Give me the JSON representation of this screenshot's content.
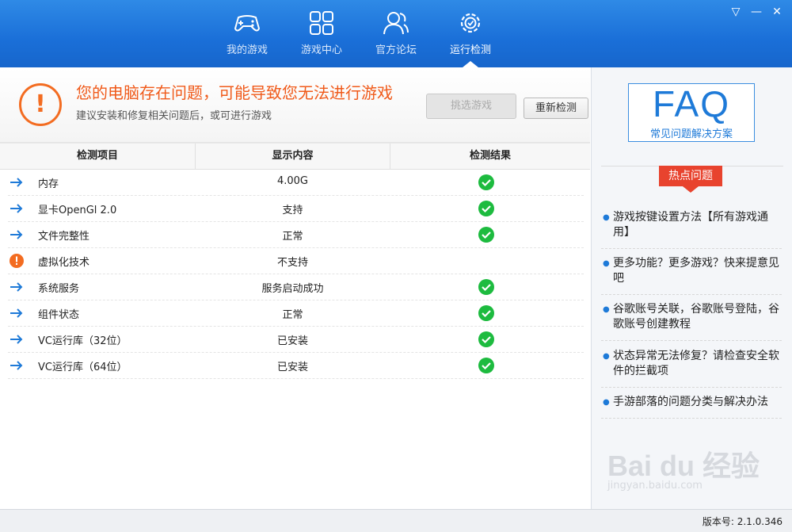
{
  "nav": [
    {
      "label": "我的游戏",
      "icon": "gamepad-icon"
    },
    {
      "label": "游戏中心",
      "icon": "grid-icon"
    },
    {
      "label": "官方论坛",
      "icon": "users-icon"
    },
    {
      "label": "运行检测",
      "icon": "gear-check-icon"
    }
  ],
  "window": {
    "menu": "▽",
    "minimize": "—",
    "close": "✕"
  },
  "warning": {
    "title": "您的电脑存在问题，可能导致您无法进行游戏",
    "subtitle": "建议安装和修复相关问题后，或可进行游戏",
    "select_game": "挑选游戏",
    "recheck": "重新检测"
  },
  "table": {
    "headers": [
      "检测项目",
      "显示内容",
      "检测结果"
    ],
    "rows": [
      {
        "name": "内存",
        "value": "4.00G",
        "status": "ok"
      },
      {
        "name": "显卡OpenGl 2.0",
        "value": "支持",
        "status": "ok"
      },
      {
        "name": "文件完整性",
        "value": "正常",
        "status": "ok"
      },
      {
        "name": "虚拟化技术",
        "value": "不支持",
        "status": "warn"
      },
      {
        "name": "系统服务",
        "value": "服务启动成功",
        "status": "ok"
      },
      {
        "name": "组件状态",
        "value": "正常",
        "status": "ok"
      },
      {
        "name": "VC运行库（32位）",
        "value": "已安装",
        "status": "ok"
      },
      {
        "name": "VC运行库（64位）",
        "value": "已安装",
        "status": "ok"
      }
    ]
  },
  "faq": {
    "big": "FAQ",
    "sub": "常见问题解决方案"
  },
  "hot": {
    "label": "热点问题",
    "items": [
      "游戏按键设置方法【所有游戏通用】",
      "更多功能？更多游戏？快来提意见吧",
      "谷歌账号关联，谷歌账号登陆，谷歌账号创建教程",
      "状态异常无法修复？请检查安全软件的拦截项",
      "手游部落的问题分类与解决办法"
    ]
  },
  "watermark": {
    "main": "Bai du 经验",
    "sub": "jingyan.baidu.com"
  },
  "status": {
    "version": "版本号: 2.1.0.346"
  },
  "colors": {
    "accent": "#1a6fd8",
    "warning": "#f36c21",
    "ok": "#1dbb3f",
    "hot": "#e8432e"
  }
}
